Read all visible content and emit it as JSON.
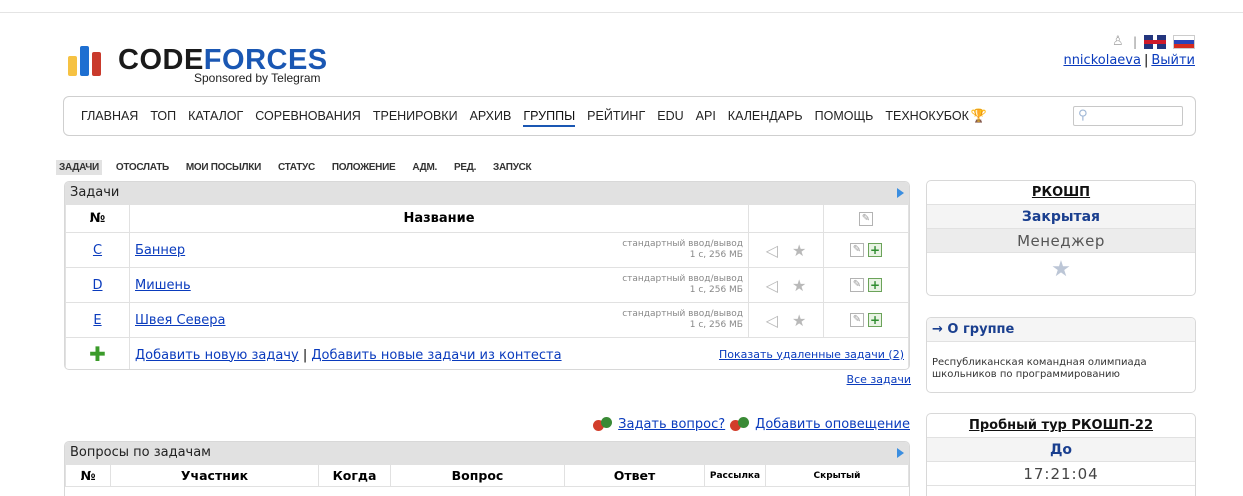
{
  "brand": {
    "colors": [
      "#f6c243",
      "#1e6fd1",
      "#c93a2c"
    ],
    "name_part1": "CODE",
    "name_part2": "FORCES",
    "sponsor": "Sponsored by Telegram"
  },
  "header": {
    "user": "nnickolaeva",
    "separator": "|",
    "logout": "Выйти",
    "lang_separator": "|"
  },
  "menu": {
    "items": [
      "ГЛАВНАЯ",
      "ТОП",
      "КАТАЛОГ",
      "СОРЕВНОВАНИЯ",
      "ТРЕНИРОВКИ",
      "АРХИВ",
      "ГРУППЫ",
      "РЕЙТИНГ",
      "EDU",
      "API",
      "КАЛЕНДАРЬ",
      "ПОМОЩЬ",
      "ТЕХНОКУБОК"
    ],
    "active": "ГРУППЫ"
  },
  "search": {
    "placeholder": ""
  },
  "submenu": {
    "items": [
      "ЗАДАЧИ",
      "ОТОСЛАТЬ",
      "МОИ ПОСЫЛКИ",
      "СТАТУС",
      "ПОЛОЖЕНИЕ",
      "АДМ.",
      "РЕД.",
      "ЗАПУСК"
    ],
    "active": "ЗАДАЧИ"
  },
  "problems": {
    "title": "Задачи",
    "col_index": "№",
    "col_name": "Название",
    "rows": [
      {
        "index": "C",
        "name": "Баннер",
        "io": "стандартный ввод/вывод",
        "limits": "1 с, 256 МБ"
      },
      {
        "index": "D",
        "name": "Мишень",
        "io": "стандартный ввод/вывод",
        "limits": "1 с, 256 МБ"
      },
      {
        "index": "E",
        "name": "Швея Севера",
        "io": "стандартный ввод/вывод",
        "limits": "1 с, 256 МБ"
      }
    ],
    "add_problem": "Добавить новую задачу",
    "add_separator": "|",
    "add_from_contest": "Добавить новые задачи из контеста",
    "show_deleted": "Показать удаленные задачи (2)",
    "all_problems": "Все задачи"
  },
  "questions": {
    "ask": "Задать вопрос?",
    "add_announcement": "Добавить оповещение",
    "title": "Вопросы по задачам",
    "columns": [
      "№",
      "Участник",
      "Когда",
      "Вопрос",
      "Ответ",
      "Рассылка",
      "Скрытый"
    ]
  },
  "sidebar": {
    "group": {
      "title": "РКОШП",
      "status": "Закрытая",
      "role": "Менеджер"
    },
    "about": {
      "title": "→ О группе",
      "text": "Республиканская командная олимпиада школьников по программированию"
    },
    "contest": {
      "title": "Пробный тур РКОШП-22",
      "before": "До",
      "time": "17:21:04"
    }
  }
}
